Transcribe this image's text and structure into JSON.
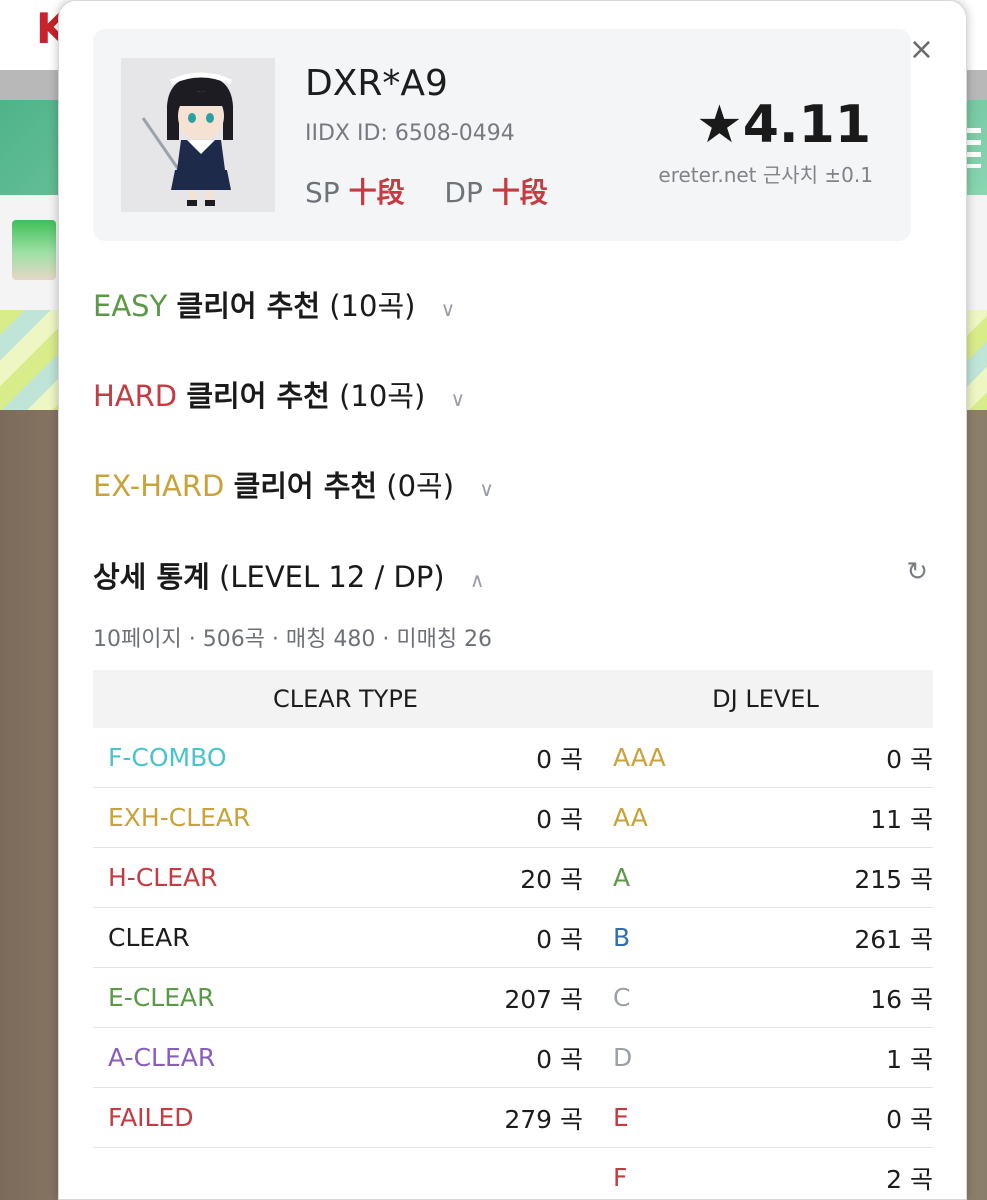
{
  "background": {
    "logo": "K"
  },
  "profile": {
    "name": "DXR*A9",
    "iidx_id": "IIDX ID: 6508-0494",
    "sp_label": "SP",
    "sp_dan": "十段",
    "dp_label": "DP",
    "dp_dan": "十段",
    "rating": "★4.11",
    "rating_note": "ereter.net 근사치 ±0.1"
  },
  "close_label": "×",
  "sections": {
    "easy": {
      "label": "EASY",
      "title": "클리어 추천",
      "count": "(10곡)"
    },
    "hard": {
      "label": "HARD",
      "title": "클리어 추천",
      "count": "(10곡)"
    },
    "exhard": {
      "label": "EX-HARD",
      "title": "클리어 추천",
      "count": "(0곡)"
    },
    "stats": {
      "title": "상세 통계",
      "detail": "(LEVEL 12 / DP)"
    }
  },
  "icons": {
    "chevron_down": "∨",
    "chevron_up": "∧",
    "refresh": "↻"
  },
  "summary": "10페이지 · 506곡 · 매칭 480 · 미매칭 26",
  "table": {
    "header_clear": "CLEAR TYPE",
    "header_dj": "DJ LEVEL",
    "rows": [
      {
        "ct": "F-COMBO",
        "ct_val": "0 곡",
        "dj": "AAA",
        "dj_val": "0 곡"
      },
      {
        "ct": "EXH-CLEAR",
        "ct_val": "0 곡",
        "dj": "AA",
        "dj_val": "11 곡"
      },
      {
        "ct": "H-CLEAR",
        "ct_val": "20 곡",
        "dj": "A",
        "dj_val": "215 곡"
      },
      {
        "ct": "CLEAR",
        "ct_val": "0 곡",
        "dj": "B",
        "dj_val": "261 곡"
      },
      {
        "ct": "E-CLEAR",
        "ct_val": "207 곡",
        "dj": "C",
        "dj_val": "16 곡"
      },
      {
        "ct": "A-CLEAR",
        "ct_val": "0 곡",
        "dj": "D",
        "dj_val": "1 곡"
      },
      {
        "ct": "FAILED",
        "ct_val": "279 곡",
        "dj": "E",
        "dj_val": "0 곡"
      },
      {
        "ct": "",
        "ct_val": "",
        "dj": "F",
        "dj_val": "2 곡"
      }
    ]
  },
  "colors": {
    "easy": "#5a9a46",
    "hard": "#c63a41",
    "exhard": "#c9a23a",
    "fcombo": "#4ac3cd",
    "assist": "#8a5cc0",
    "dj_b": "#2f6fb2"
  }
}
